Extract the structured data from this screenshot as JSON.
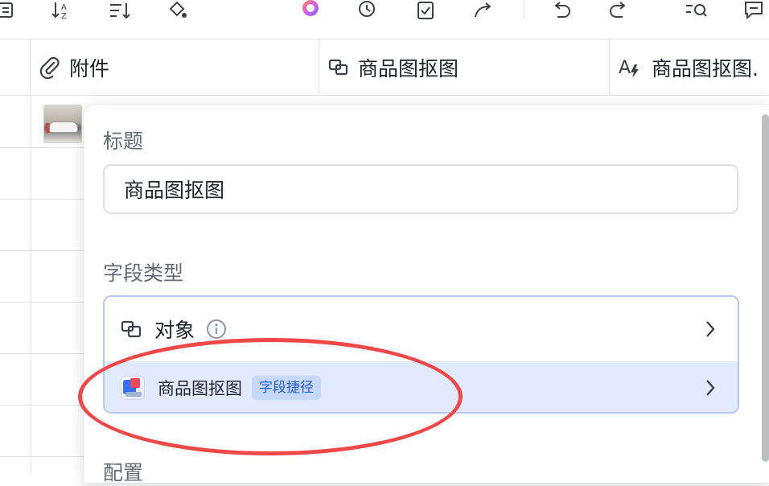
{
  "toolbar": {
    "icons": [
      "list-icon",
      "sort-az-icon",
      "sort-lines-icon",
      "paint-bucket-icon",
      "ai-assistant-icon",
      "history-icon",
      "checklist-icon",
      "share-icon",
      "undo-icon",
      "redo-icon",
      "search-list-icon",
      "comment-icon"
    ]
  },
  "columns": [
    {
      "label": "附件",
      "icon": "paperclip-icon"
    },
    {
      "label": "商品图抠图",
      "icon": "object-icon"
    },
    {
      "label": "商品图抠图.",
      "icon": "ai-text-icon"
    }
  ],
  "panel": {
    "title_label": "标题",
    "title_value": "商品图抠图",
    "field_type_label": "字段类型",
    "type_option": "对象",
    "shortcut_name": "商品图抠图",
    "shortcut_badge": "字段捷径",
    "config_label": "配置"
  },
  "colors": {
    "accent": "#3370ff",
    "highlight_row": "#e1eaff",
    "annotation": "#f04747"
  }
}
